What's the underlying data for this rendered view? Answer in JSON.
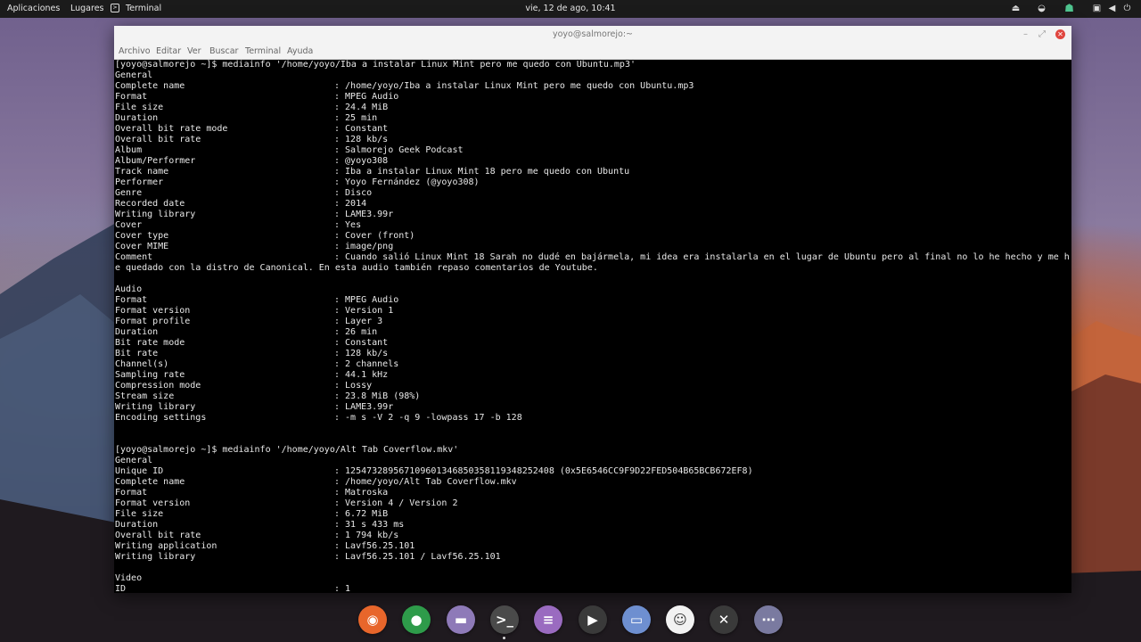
{
  "topbar": {
    "applications": "Aplicaciones",
    "places": "Lugares",
    "active_app": "Terminal",
    "datetime": "vie, 12 de ago, 10:41",
    "tray_icons": [
      "eject-icon",
      "network-icon",
      "ghost-icon",
      "screen-icon",
      "volume-icon",
      "power-icon"
    ]
  },
  "window": {
    "title": "yoyo@salmorejo:~",
    "menu": [
      "Archivo",
      "Editar",
      "Ver",
      "Buscar",
      "Terminal",
      "Ayuda"
    ]
  },
  "terminal": {
    "lines": [
      {
        "t": "[yoyo@salmorejo ~]$ mediainfo '/home/yoyo/Iba a instalar Linux Mint pero me quedo con Ubuntu.mp3'"
      },
      {
        "t": "General"
      },
      {
        "k": "Complete name",
        "v": ": /home/yoyo/Iba a instalar Linux Mint pero me quedo con Ubuntu.mp3"
      },
      {
        "k": "Format",
        "v": ": MPEG Audio"
      },
      {
        "k": "File size",
        "v": ": 24.4 MiB"
      },
      {
        "k": "Duration",
        "v": ": 25 min"
      },
      {
        "k": "Overall bit rate mode",
        "v": ": Constant"
      },
      {
        "k": "Overall bit rate",
        "v": ": 128 kb/s"
      },
      {
        "k": "Album",
        "v": ": Salmorejo Geek Podcast"
      },
      {
        "k": "Album/Performer",
        "v": ": @yoyo308"
      },
      {
        "k": "Track name",
        "v": ": Iba a instalar Linux Mint 18 pero me quedo con Ubuntu"
      },
      {
        "k": "Performer",
        "v": ": Yoyo Fernández (@yoyo308)"
      },
      {
        "k": "Genre",
        "v": ": Disco"
      },
      {
        "k": "Recorded date",
        "v": ": 2014"
      },
      {
        "k": "Writing library",
        "v": ": LAME3.99r"
      },
      {
        "k": "Cover",
        "v": ": Yes"
      },
      {
        "k": "Cover type",
        "v": ": Cover (front)"
      },
      {
        "k": "Cover MIME",
        "v": ": image/png"
      },
      {
        "k": "Comment",
        "v": ": Cuando salió Linux Mint 18 Sarah no dudé en bajármela, mi idea era instalarla en el lugar de Ubuntu pero al final no lo he hecho y me h"
      },
      {
        "t": "e quedado con la distro de Canonical. En esta audio también repaso comentarios de Youtube."
      },
      {
        "t": ""
      },
      {
        "t": "Audio"
      },
      {
        "k": "Format",
        "v": ": MPEG Audio"
      },
      {
        "k": "Format version",
        "v": ": Version 1"
      },
      {
        "k": "Format profile",
        "v": ": Layer 3"
      },
      {
        "k": "Duration",
        "v": ": 26 min"
      },
      {
        "k": "Bit rate mode",
        "v": ": Constant"
      },
      {
        "k": "Bit rate",
        "v": ": 128 kb/s"
      },
      {
        "k": "Channel(s)",
        "v": ": 2 channels"
      },
      {
        "k": "Sampling rate",
        "v": ": 44.1 kHz"
      },
      {
        "k": "Compression mode",
        "v": ": Lossy"
      },
      {
        "k": "Stream size",
        "v": ": 23.8 MiB (98%)"
      },
      {
        "k": "Writing library",
        "v": ": LAME3.99r"
      },
      {
        "k": "Encoding settings",
        "v": ": -m s -V 2 -q 9 -lowpass 17 -b 128"
      },
      {
        "t": ""
      },
      {
        "t": ""
      },
      {
        "t": "[yoyo@salmorejo ~]$ mediainfo '/home/yoyo/Alt Tab Coverflow.mkv'"
      },
      {
        "t": "General"
      },
      {
        "k": "Unique ID",
        "v": ": 125473289567109601346850358119348252408 (0x5E6546CC9F9D22FED504B65BCB672EF8)"
      },
      {
        "k": "Complete name",
        "v": ": /home/yoyo/Alt Tab Coverflow.mkv"
      },
      {
        "k": "Format",
        "v": ": Matroska"
      },
      {
        "k": "Format version",
        "v": ": Version 4 / Version 2"
      },
      {
        "k": "File size",
        "v": ": 6.72 MiB"
      },
      {
        "k": "Duration",
        "v": ": 31 s 433 ms"
      },
      {
        "k": "Overall bit rate",
        "v": ": 1 794 kb/s"
      },
      {
        "k": "Writing application",
        "v": ": Lavf56.25.101"
      },
      {
        "k": "Writing library",
        "v": ": Lavf56.25.101 / Lavf56.25.101"
      },
      {
        "t": ""
      },
      {
        "t": "Video"
      },
      {
        "k": "ID",
        "v": ": 1"
      }
    ]
  },
  "dock": [
    {
      "name": "firefox-icon",
      "color": "#e8662b",
      "glyph": "◉"
    },
    {
      "name": "chrome-icon",
      "color": "#2e9b4a",
      "glyph": "●"
    },
    {
      "name": "files-icon",
      "color": "#8e7ab8",
      "glyph": "▬"
    },
    {
      "name": "terminal-icon",
      "color": "#4a4a4a",
      "glyph": ">_"
    },
    {
      "name": "text-editor-icon",
      "color": "#9a6bc0",
      "glyph": "≡"
    },
    {
      "name": "media-player-icon",
      "color": "#3a3a3a",
      "glyph": "▶"
    },
    {
      "name": "screen-capture-icon",
      "color": "#6e8fd0",
      "glyph": "▭"
    },
    {
      "name": "ghost-app-icon",
      "color": "#f2f2f2",
      "glyph": "☺"
    },
    {
      "name": "network-app-icon",
      "color": "#3a3a3a",
      "glyph": "✕"
    },
    {
      "name": "app-grid-icon",
      "color": "#7a7aa0",
      "glyph": "⋯"
    }
  ]
}
